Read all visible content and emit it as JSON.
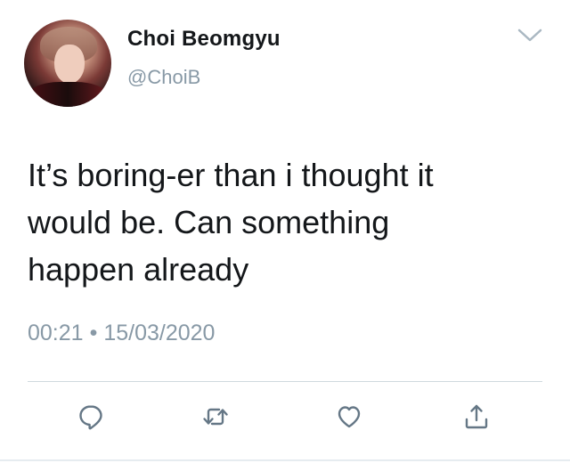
{
  "tweet": {
    "display_name": "Choi Beomgyu",
    "handle": "@ChoiB",
    "text_lines": [
      "It’s boring-er than i thought it",
      "would be. Can something",
      "happen already"
    ],
    "time": "00:21",
    "separator": "•",
    "date": "15/03/2020"
  },
  "icons": {
    "menu": "chevron-down-icon",
    "reply": "reply-icon",
    "retweet": "retweet-icon",
    "like": "heart-icon",
    "share": "share-icon"
  },
  "colors": {
    "text": "#14171a",
    "secondary": "#8899a6",
    "icon": "#657786",
    "divider": "#cfd9de"
  }
}
